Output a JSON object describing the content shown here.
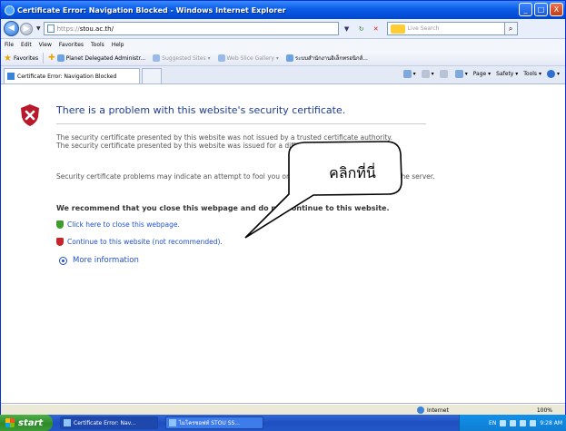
{
  "window": {
    "title": "Certificate Error: Navigation Blocked - Windows Internet Explorer",
    "buttons": [
      "_",
      "□",
      "X"
    ]
  },
  "address_bar": {
    "prefix": "https://",
    "host": "stou.ac.th/",
    "search_placeholder": "Live Search"
  },
  "menu": [
    "File",
    "Edit",
    "View",
    "Favorites",
    "Tools",
    "Help"
  ],
  "favorites_bar": {
    "label": "Favorites",
    "items": [
      {
        "label": "Planet Delegated Administr...",
        "dim": false
      },
      {
        "label": "Suggested Sites ▾",
        "dim": true
      },
      {
        "label": "Web Slice Gallery ▾",
        "dim": true
      },
      {
        "label": "ระบบสำนักงานอิเล็กทรอนิกส์...",
        "dim": false
      }
    ]
  },
  "tab": {
    "label": "Certificate Error: Navigation Blocked"
  },
  "command_bar": [
    "Page ▾",
    "Safety ▾",
    "Tools ▾"
  ],
  "page": {
    "heading": "There is a problem with this website's security certificate.",
    "para1": "The security certificate presented by this website was not issued by a trusted certificate authority.\nThe security certificate presented by this website was issued for a different website's address.",
    "para2": "Security certificate problems may indicate an attempt to fool you or intercept any data you send to the server.",
    "recommendation": "We recommend that you close this webpage and do not continue to this website.",
    "close_link": "Click here to close this webpage.",
    "continue_link": "Continue to this website (not recommended).",
    "more_info": "More information"
  },
  "annotation": {
    "text": "คลิกที่นี่"
  },
  "status_bar": {
    "zone": "Internet",
    "zoom": "100%"
  },
  "taskbar": {
    "start": "start",
    "tasks": [
      "Certificate Error: Nav...",
      "ไมโครซอฟท์ STOU SS..."
    ],
    "clock": "9:28 AM",
    "lang": "EN"
  }
}
